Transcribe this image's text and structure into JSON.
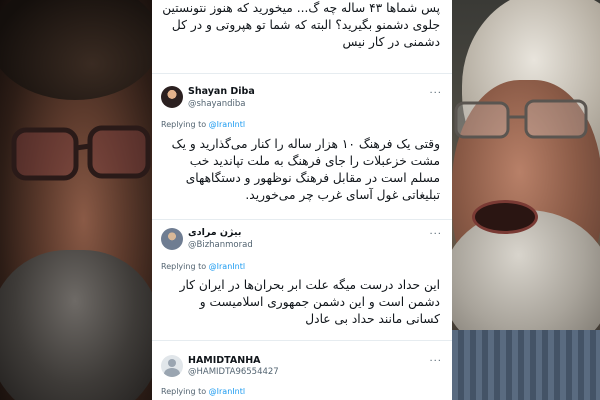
{
  "tweets": [
    {
      "text": "پس شماها ۴۳ ساله چه گ... میخورید که هنوز نتونستین جلوی دشمنو بگیرید؟ البته که شما تو هپروتی و در کل دشمنی در کار نیس"
    },
    {
      "author_name": "Shayan Diba",
      "author_handle": "@shayandiba",
      "replying_prefix": "Replying to ",
      "replying_to": "@IranIntl",
      "text": "وقتی یک فرهنگ ۱۰ هزار ساله را کنار می‌گذارید و یک مشت خزعبلات را جای فرهنگ به ملت تپاندید خب مسلم است در مقابل فرهنگ نوظهور و دستگاههای تبلیغاتی غول آسای غرب چر می‌خورید."
    },
    {
      "author_name": "بیژن مرادی",
      "author_handle": "@Bizhanmorad",
      "replying_prefix": "Replying to ",
      "replying_to": "@IranIntl",
      "text": "این حداد درست میگه علت ابر بحران‌ها در ایران کار دشمن است و این دشمن جمهوری اسلامیست و کسانی مانند حداد بی عادل"
    },
    {
      "author_name": "HAMIDTANHA",
      "author_handle": "@HAMIDTA96554427",
      "replying_prefix": "Replying to ",
      "replying_to": "@IranIntl"
    }
  ],
  "more_icon_glyph": "···",
  "colors": {
    "text": "#0f1419",
    "secondary": "#536471",
    "link": "#1d9bf0",
    "divider": "#e6ecf0"
  }
}
